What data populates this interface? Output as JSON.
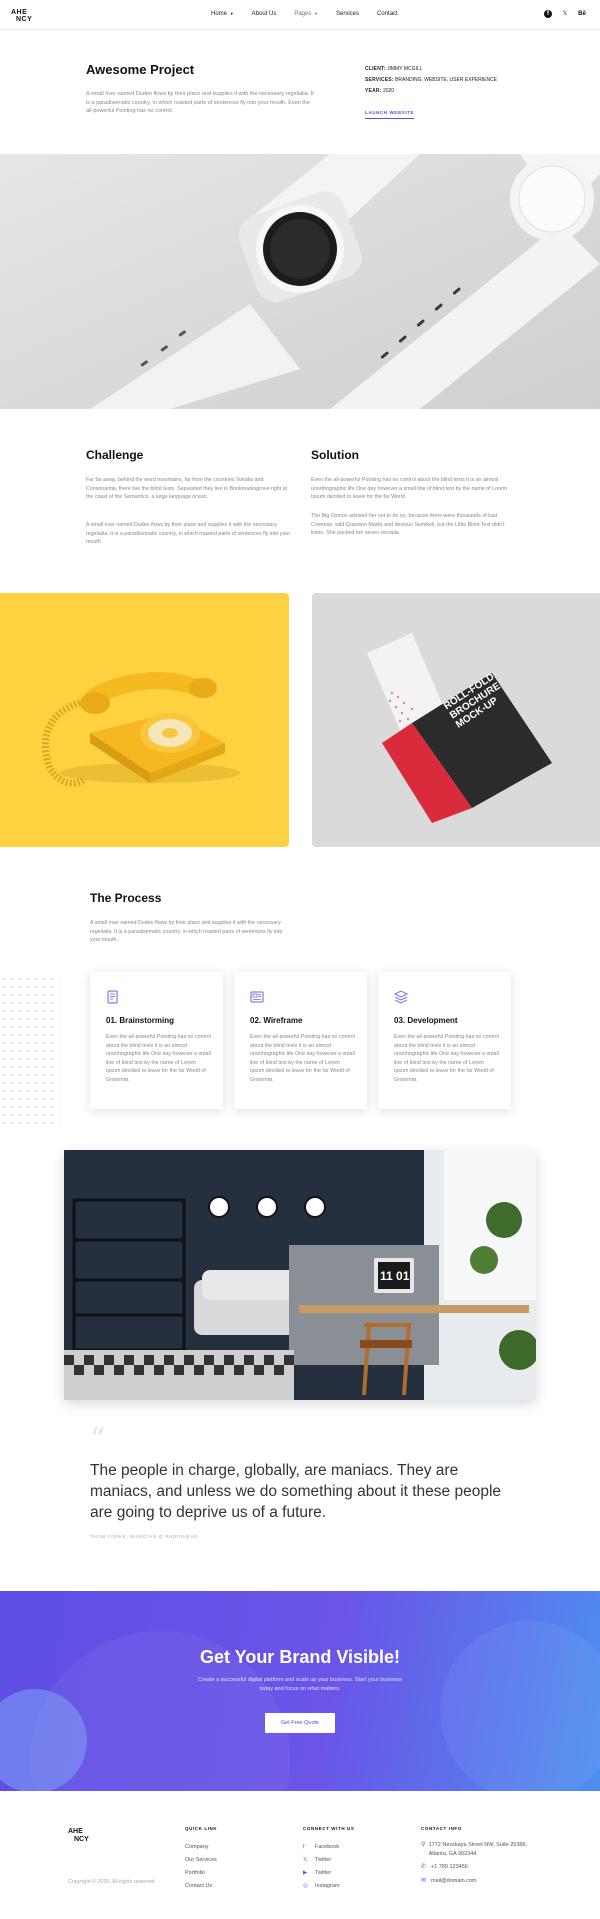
{
  "nav": {
    "logo_line1": "AHE",
    "logo_line2": "NCY",
    "items": [
      {
        "label": "Home",
        "caret": "▼"
      },
      {
        "label": "About Us",
        "caret": ""
      },
      {
        "label": "Pages",
        "caret": "▼"
      },
      {
        "label": "Services",
        "caret": ""
      },
      {
        "label": "Contact",
        "caret": ""
      }
    ],
    "social": [
      "f",
      "𝕏",
      "Bē"
    ]
  },
  "hero": {
    "title": "Awesome Project",
    "text": "A small river named Duden flows by their place and supplies it with the necessary regelialia. It is a paradisematic country, in which roasted parts of sentences fly into your mouth. Even the all-powerful Pointing has no control.",
    "client_label": "CLIENT:",
    "client_value": "JIMMY MCGILL",
    "services_label": "SERVICES:",
    "services_value": "BRANDING, WEBSITE, USER EXPERIENCE",
    "year_label": "YEAR:",
    "year_value": "2020",
    "launch_label": "LAUNCH WEBSITE"
  },
  "challenge": {
    "title": "Challenge",
    "p1": "Far far away, behind the word mountains, far from the countries Vokalia and Consonantia, there live the blind texts. Separated they live in Bookmarksgrove right at the coast of the Semantics, a large language ocean.",
    "p2": "A small river named Duden flows by their place and supplies it with the necessary regelialia. It is a paradisematic country, in which roasted parts of sentences fly into your mouth."
  },
  "solution": {
    "title": "Solution",
    "p1": "Even the all-powerful Pointing has no control about the blind texts it is an almost unorthographic life One day however a small line of blind text by the name of Lorem Ipsum decided to leave for the far World.",
    "p2": "The Big Oxmox advised her not to do so, because there were thousands of bad Commas, wild Question Marks and devious Semikoli, but the Little Blind Text didn't listen. She packed her seven versalia."
  },
  "brochure": {
    "line1": "ROLL-FOLD",
    "line2": "BROCHURE",
    "line3": "MOCK-UP"
  },
  "process": {
    "title": "The Process",
    "text": "A small river named Duden flows by their place and supplies it with the necessary regelialia. It is a paradisematic country, in which roasted parts of sentences fly into your mouth.",
    "cards": [
      {
        "title": "01. Brainstorming",
        "text": "Even the all-powerful Pointing has no control about the blind texts it is an almost unorthographic life One day however a small line of blind text by the name of Lorem Ipsum decided to leave for the far World of Grammar."
      },
      {
        "title": "02. Wireframe",
        "text": "Even the all-powerful Pointing has no control about the blind texts it is an almost unorthographic life One day however a small line of blind text by the name of Lorem Ipsum decided to leave for the far World of Grammar."
      },
      {
        "title": "03. Development",
        "text": "Even the all-powerful Pointing has no control about the blind texts it is an almost unorthographic life One day however a small line of blind text by the name of Lorem Ipsum decided to leave for the far World of Grammar."
      }
    ]
  },
  "interior": {
    "clock_text": "11 01"
  },
  "quote": {
    "mark": "“",
    "text": "The people in charge, globally, are maniacs. They are maniacs, and unless we do something about it these people are going to deprive us of a future.",
    "author": "THOM YORKE, MUSICIAN @ RADIOHEAD"
  },
  "cta": {
    "title": "Get Your Brand Visible!",
    "text": "Create a successful digital platform and scale up your business. Start your business today and focus on what matters.",
    "button": "Get Free Quote"
  },
  "footer": {
    "logo_line1": "AHE",
    "logo_line2": "NCY",
    "copyright": "Copyright © 2020. All rights reserved.",
    "quick_title": "QUICK LINK",
    "quick_links": [
      "Company",
      "Our Services",
      "Portfolio",
      "Contact Us"
    ],
    "connect_title": "CONNECT WITH US",
    "connect_links": [
      {
        "icon": "f",
        "label": "Facebook"
      },
      {
        "icon": "𝕏",
        "label": "Twitter"
      },
      {
        "icon": "▶",
        "label": "Twitter"
      },
      {
        "icon": "◎",
        "label": "Instagram"
      }
    ],
    "contact_title": "CONTACT INFO",
    "address": "1772 Nevskaya Street NW, Suite 25386, Atlanta, GA 902344",
    "phone": "+1 789 123456",
    "email": "mail@domain.com"
  },
  "colors": {
    "accent": "#5b4ee0",
    "yellow": "#fdd13f",
    "cta_start": "#5e4ee3",
    "cta_end": "#4e8ff0"
  }
}
